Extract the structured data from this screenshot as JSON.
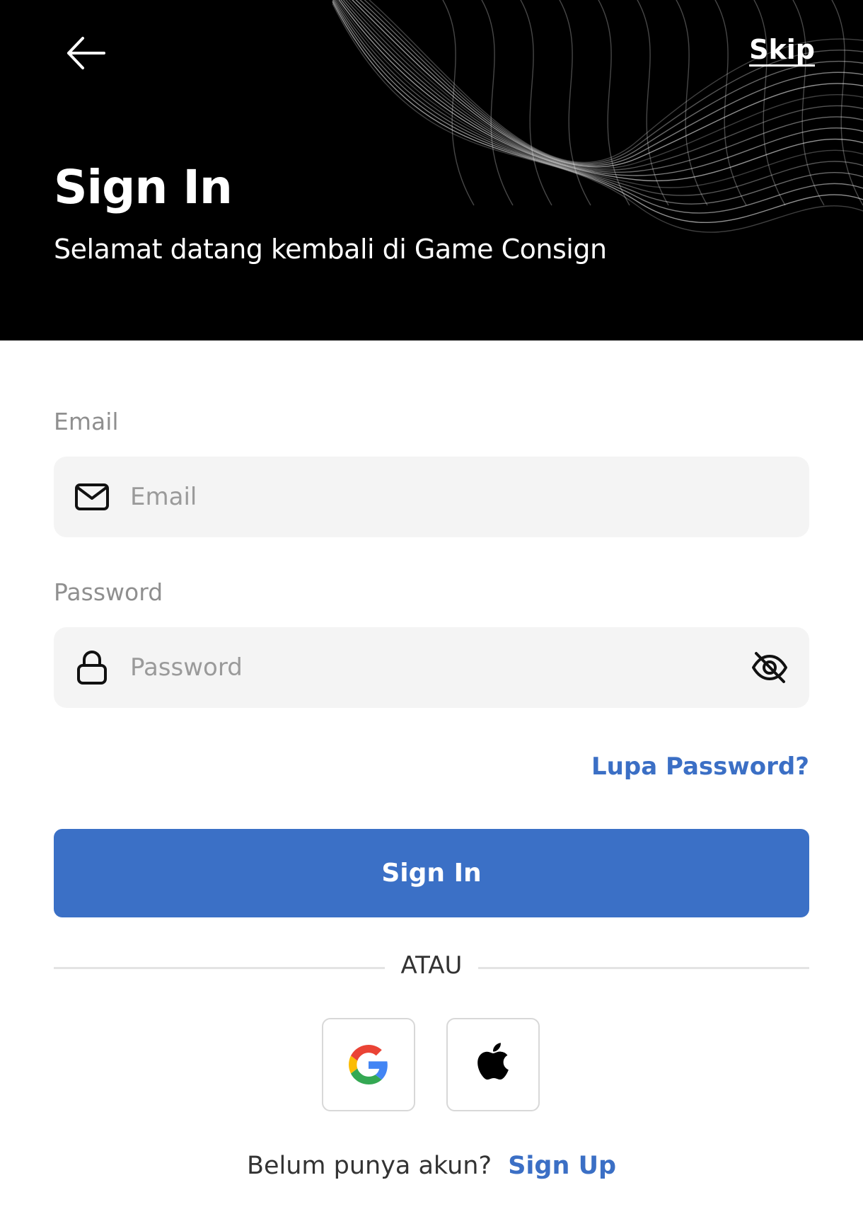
{
  "header": {
    "title": "Sign In",
    "subtitle": "Selamat datang kembali di Game Consign",
    "skip_label": "Skip",
    "back_icon": "arrow-left-icon"
  },
  "email": {
    "label": "Email",
    "placeholder": "Email",
    "value": "",
    "icon": "mail-icon"
  },
  "password": {
    "label": "Password",
    "placeholder": "Password",
    "value": "",
    "icon": "lock-icon",
    "toggle_icon": "eye-off-icon"
  },
  "forgot_label": "Lupa Password?",
  "signin_label": "Sign In",
  "divider_label": "ATAU",
  "social": [
    {
      "provider": "google",
      "icon": "google-icon"
    },
    {
      "provider": "apple",
      "icon": "apple-icon"
    }
  ],
  "footer": {
    "prompt": "Belum punya akun?",
    "signup_label": "Sign Up"
  },
  "colors": {
    "header_bg": "#000000",
    "primary": "#3b70c6",
    "link": "#3b6fc5",
    "input_bg": "#f4f4f4",
    "label": "#8f8f8f"
  }
}
